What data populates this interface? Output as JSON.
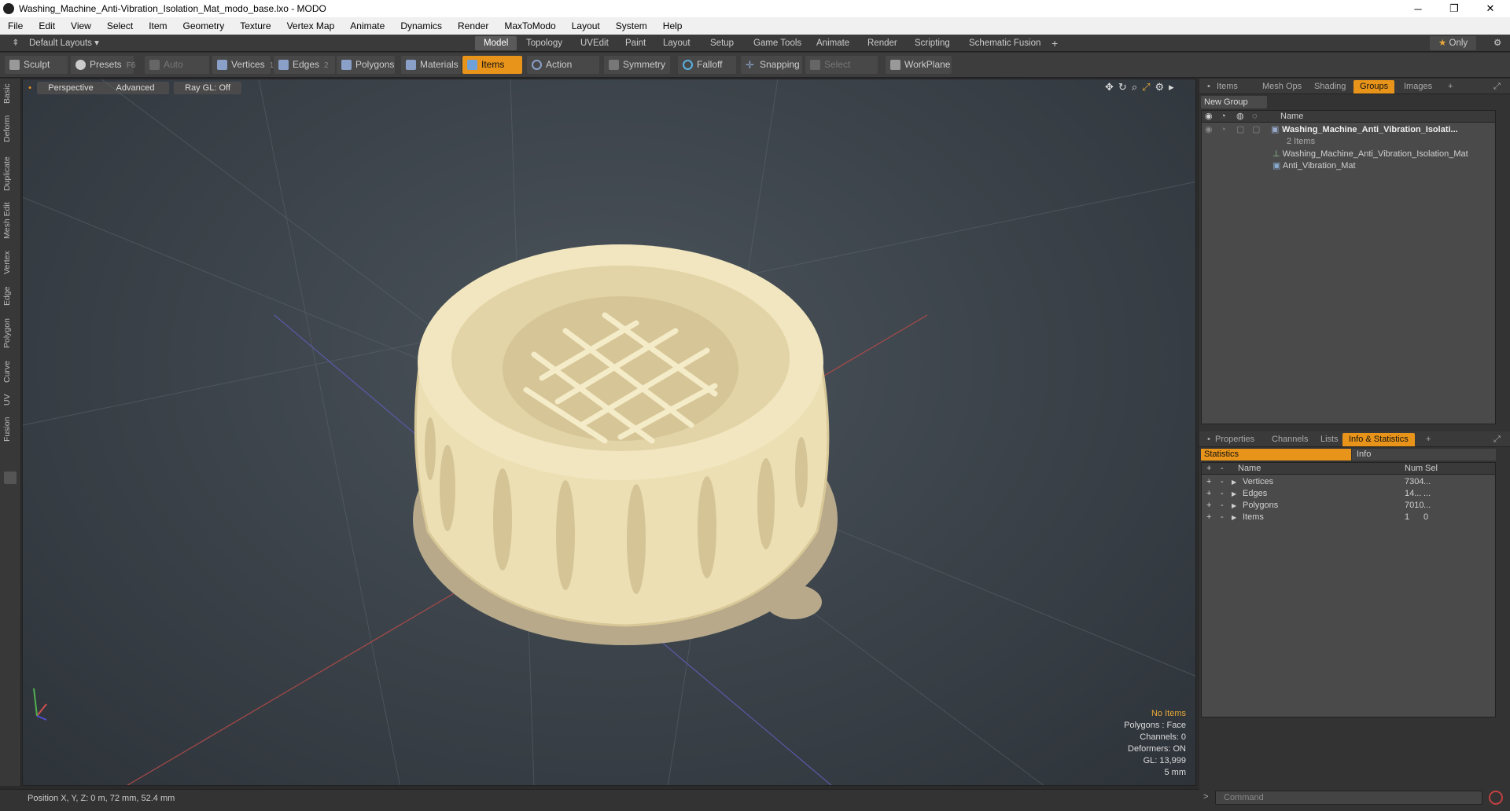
{
  "window": {
    "title": "Washing_Machine_Anti-Vibration_Isolation_Mat_modo_base.lxo - MODO"
  },
  "menu": [
    "File",
    "Edit",
    "View",
    "Select",
    "Item",
    "Geometry",
    "Texture",
    "Vertex Map",
    "Animate",
    "Dynamics",
    "Render",
    "MaxToModo",
    "Layout",
    "System",
    "Help"
  ],
  "layoutbar": {
    "preset": "Default Layouts ▾",
    "tabs": [
      "Model",
      "Topology",
      "UVEdit",
      "Paint",
      "Layout",
      "Setup",
      "Game Tools",
      "Animate",
      "Render",
      "Scripting",
      "Schematic Fusion"
    ],
    "active": "Model",
    "only": "Only"
  },
  "toolbar": {
    "sculpt": "Sculpt",
    "presets": "Presets",
    "presets_key": "F6",
    "auto_select": "Auto Select",
    "vertices": "Vertices",
    "vertices_key": "1",
    "edges": "Edges",
    "edges_key": "2",
    "polygons": "Polygons",
    "materials": "Materials",
    "items": "Items",
    "action_center": "Action Center",
    "symmetry": "Symmetry",
    "falloff": "Falloff",
    "snapping": "Snapping",
    "select_through": "Select Through",
    "workplane": "WorkPlane"
  },
  "lefttabs": [
    "Basic",
    "Deform",
    "Duplicate",
    "Mesh Edit",
    "Vertex",
    "Edge",
    "Polygon",
    "Curve",
    "UV",
    "Fusion"
  ],
  "viewport": {
    "view": "Perspective",
    "advanced": "Advanced",
    "raygl": "Ray GL: Off",
    "info": {
      "items": "No Items",
      "polygons": "Polygons : Face",
      "channels": "Channels: 0",
      "deformers": "Deformers: ON",
      "gl": "GL: 13,999",
      "scale": "5 mm"
    }
  },
  "status": {
    "position": "Position X, Y, Z:  0 m, 72 mm, 52.4 mm"
  },
  "groups_panel": {
    "tabs": [
      "Items",
      "Mesh Ops",
      "Shading",
      "Groups",
      "Images"
    ],
    "active": "Groups",
    "new_group": "New Group",
    "col_name": "Name",
    "root": "Washing_Machine_Anti_Vibration_Isolati...",
    "root_count": "2 Items",
    "children": [
      "Washing_Machine_Anti_Vibration_Isolation_Mat",
      "Anti_Vibration_Mat"
    ]
  },
  "info_panel": {
    "tabs": [
      "Properties",
      "Channels",
      "Lists",
      "Info & Statistics"
    ],
    "active": "Info & Statistics",
    "sub_statistics": "Statistics",
    "sub_info": "Info",
    "cols": {
      "name": "Name",
      "num": "Num",
      "sel": "Sel"
    },
    "rows": [
      {
        "name": "Vertices",
        "num": "7304",
        "sel": "..."
      },
      {
        "name": "Edges",
        "num": "14...",
        "sel": "..."
      },
      {
        "name": "Polygons",
        "num": "7010",
        "sel": "..."
      },
      {
        "name": "Items",
        "num": "1",
        "sel": "0"
      }
    ]
  },
  "command": {
    "placeholder": "Command"
  }
}
